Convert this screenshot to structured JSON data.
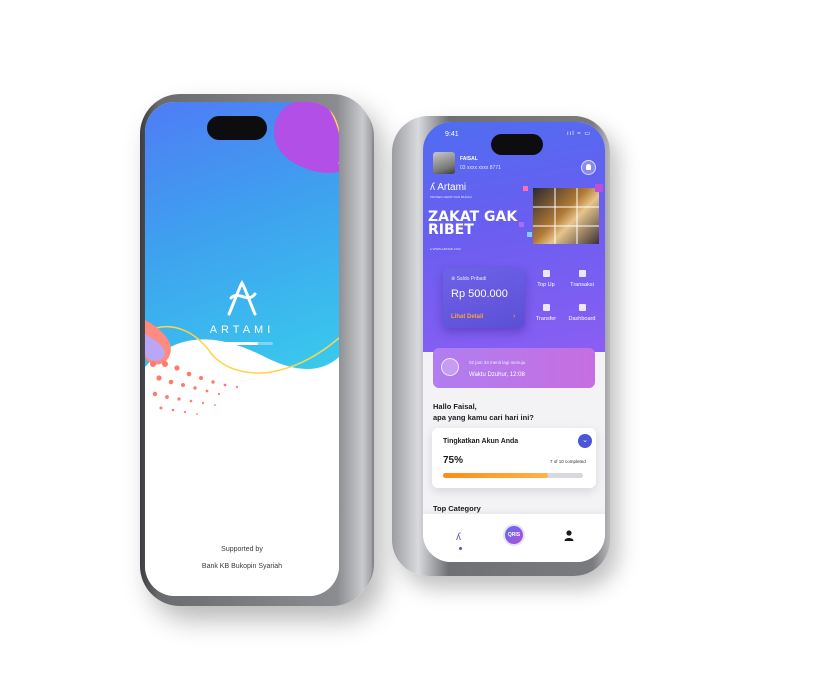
{
  "splash": {
    "brand": "ARTAMI",
    "progress": 0.75,
    "support_line1": "Supported by",
    "support_line2": "Bank KB Bukopin Syariah"
  },
  "home": {
    "status_time": "9:41",
    "status_icons": "ııl ≈ ▭",
    "username": "FAISAL",
    "account": "03 xxxx xxxx 8771",
    "banner": {
      "brand": "Artami",
      "tagline": "PROSES CEPAT DAN MUDAH",
      "title": "ZAKAT GAK RIBET",
      "url": "● WWW.ARTAMI.COM"
    },
    "wallet": {
      "label": "Saldo Pribadi",
      "amount": "Rp 500.000",
      "link": "Lihat Detail",
      "chevron": "›"
    },
    "actions": [
      "Top Up",
      "Transaksi",
      "Transfer",
      "Dashboard"
    ],
    "prayer": {
      "time_left": "02 jam 33 menit lagi menuju",
      "name": "Waktu Dzuhur, 12:08"
    },
    "greeting_line1": "Hallo Faisal,",
    "greeting_line2": "apa yang kamu cari hari ini?",
    "upgrade": {
      "title": "Tingkatkan Akun Anda",
      "percent": "75%",
      "progress": 0.75,
      "count": "7 of 10 completed"
    },
    "top_category": "Top Category",
    "nav": {
      "home_icon": "artami-logo-icon",
      "qris": "QRIS",
      "profile_icon": "person-icon"
    }
  },
  "colors": {
    "primary": "#4b55d8",
    "accent_orange": "#ff9f43",
    "gradient_blue": "#3f9fef",
    "gradient_purple": "#8a5ef3"
  }
}
